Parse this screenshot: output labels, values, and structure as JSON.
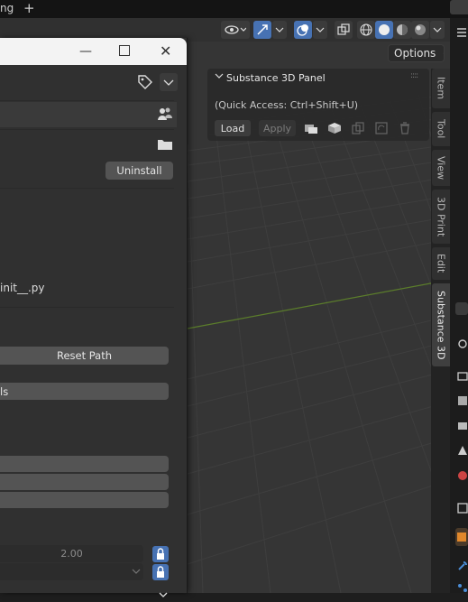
{
  "topbar": {
    "tab_fragment": "ng",
    "add_tab": "+"
  },
  "header": {
    "options_label": "Options"
  },
  "panel": {
    "title": "Substance 3D Panel",
    "quick_access": "(Quick Access: Ctrl+Shift+U)",
    "load_label": "Load",
    "apply_label": "Apply"
  },
  "sidebar_tabs": [
    "Item",
    "Tool",
    "View",
    "3D Print",
    "Edit",
    "Substance 3D"
  ],
  "prefs": {
    "uninstall_label": "Uninstall",
    "file_fragment": "init__.py",
    "reset_path_label": "Reset Path",
    "tools_fragment": "ls",
    "number_value": "2.00"
  },
  "colors": {
    "accent": "#4772b3",
    "grid_axis": "#5b7d2b",
    "viewport": "#353535"
  }
}
